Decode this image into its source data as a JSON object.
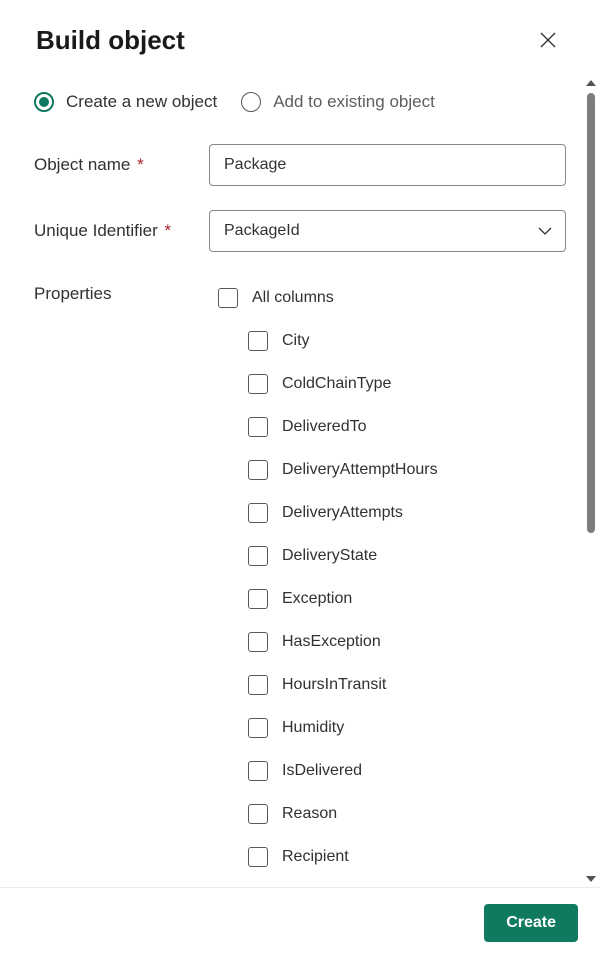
{
  "header": {
    "title": "Build object"
  },
  "mode": {
    "create_label": "Create a new object",
    "add_label": "Add to existing object",
    "selected": "create"
  },
  "form": {
    "object_name_label": "Object name",
    "object_name_value": "Package",
    "unique_id_label": "Unique Identifier",
    "unique_id_value": "PackageId",
    "properties_label": "Properties"
  },
  "properties": {
    "all_label": "All columns",
    "items": [
      "City",
      "ColdChainType",
      "DeliveredTo",
      "DeliveryAttemptHours",
      "DeliveryAttempts",
      "DeliveryState",
      "Exception",
      "HasException",
      "HoursInTransit",
      "Humidity",
      "IsDelivered",
      "Reason",
      "Recipient"
    ]
  },
  "footer": {
    "create_label": "Create"
  },
  "colors": {
    "accent": "#0f7a5f"
  }
}
